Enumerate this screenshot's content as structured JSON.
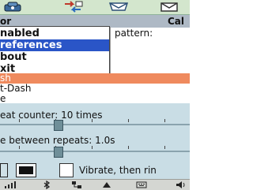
{
  "tabs": [
    "phone-icon",
    "transfer-icon",
    "mail-icon",
    "envelope-icon"
  ],
  "title": {
    "left": "or",
    "right": "Cal"
  },
  "options": {
    "pattern_label": "pattern:"
  },
  "menu": {
    "items": [
      {
        "label": "nabled"
      },
      {
        "label": "references",
        "selected": true
      },
      {
        "label": "bout"
      },
      {
        "label": "xit"
      }
    ]
  },
  "list": {
    "rows": [
      {
        "label": "sh",
        "selected": true
      },
      {
        "label": "t-Dash"
      },
      {
        "label": "e"
      }
    ]
  },
  "settings": {
    "repeat_label": "eat counter: 10 times",
    "between_label": "e between repeats: 1.0s",
    "vibrate_label": "Vibrate, then rin",
    "vibrate_checked": false,
    "repeat_position": 0.3,
    "between_position": 0.3
  },
  "statusbar": {
    "icons": [
      "signal-icon",
      "bluetooth-icon",
      "network-icon",
      "connectivity-icon",
      "keyboard-icon",
      "volume-icon"
    ]
  },
  "colors": {
    "selection": "#2a55c7",
    "list_highlight": "#ef8a5e",
    "panel": "#c9dde5",
    "titlebar": "#aeb9c5",
    "tabbar": "#d3e6cd"
  }
}
